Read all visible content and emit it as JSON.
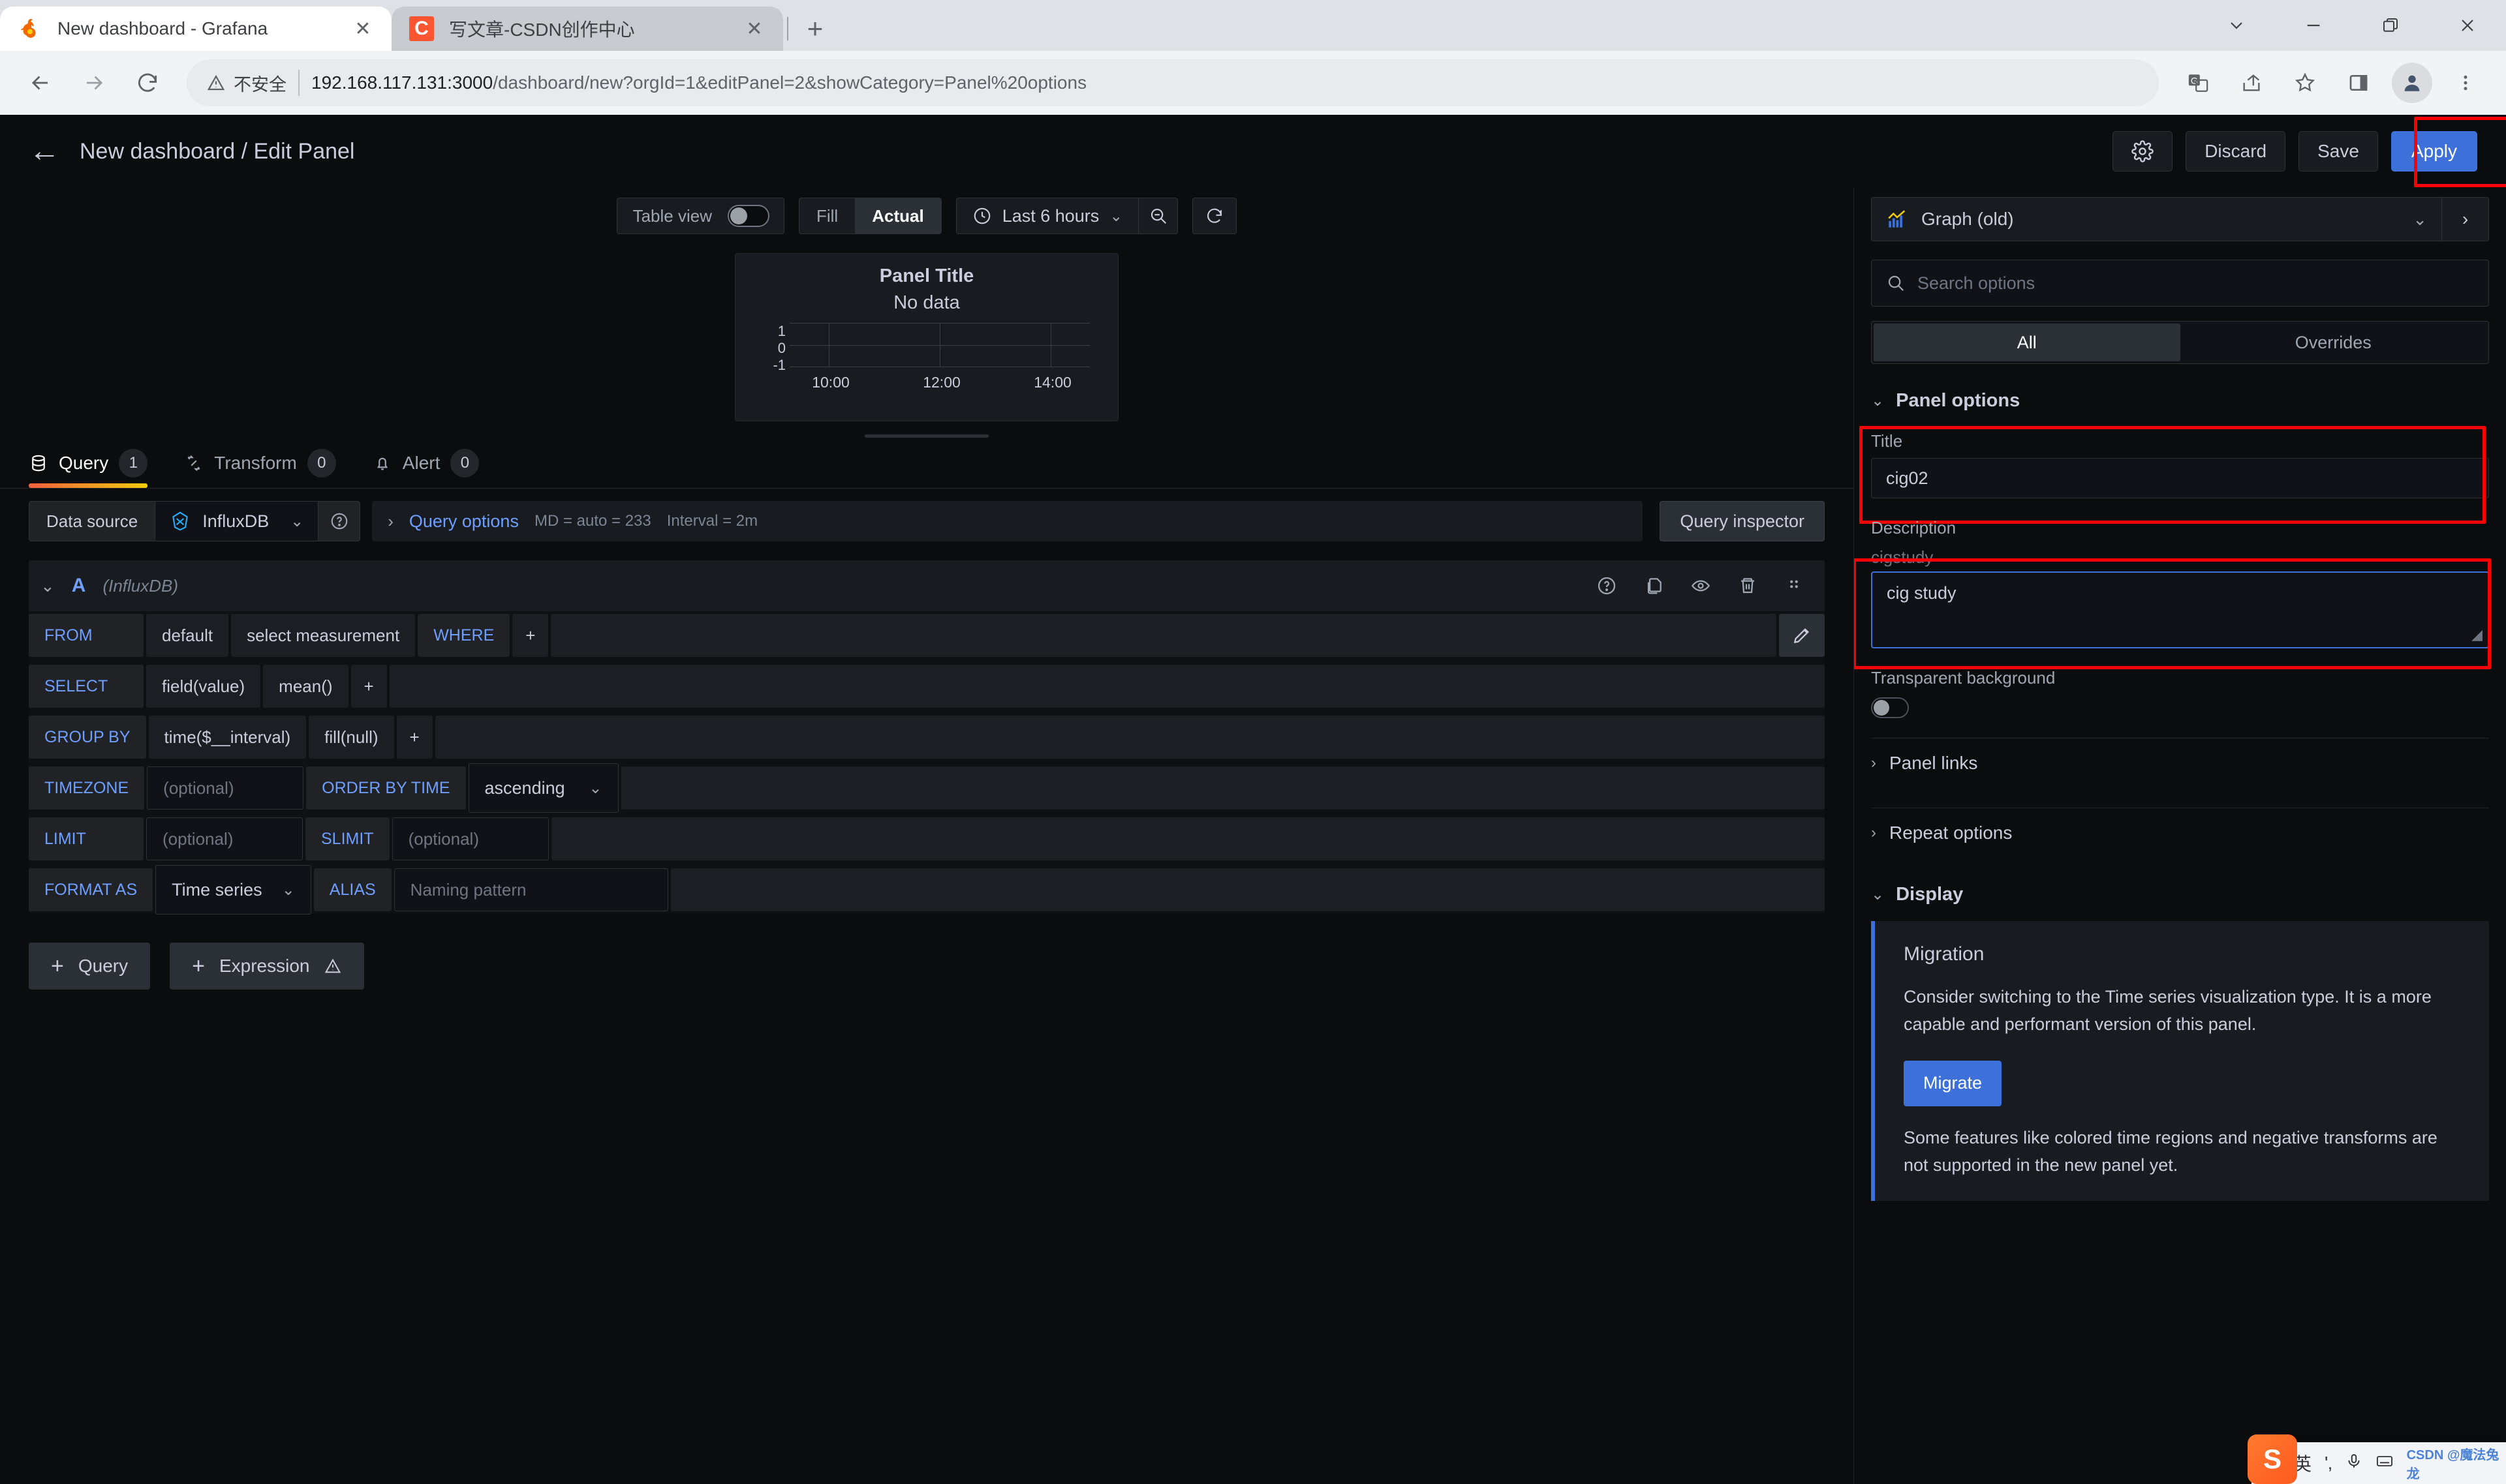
{
  "browser": {
    "tabs": [
      {
        "title": "New dashboard - Grafana",
        "favicon": "grafana-logo-icon",
        "active": true
      },
      {
        "title": "写文章-CSDN创作中心",
        "favicon": "csdn-logo-icon",
        "active": false
      }
    ],
    "new_tab_label": "+",
    "close_label": "✕",
    "window_controls": [
      "chevron-down",
      "minimize",
      "restore",
      "close"
    ],
    "omnibox": {
      "warning_text": "不安全",
      "url_host": "192.168.117.131:3000",
      "url_path": "/dashboard/new?orgId=1&editPanel=2&showCategory=Panel%20options"
    }
  },
  "grafana": {
    "header": {
      "breadcrumb": "New dashboard / Edit Panel",
      "settings_label": "",
      "discard_label": "Discard",
      "save_label": "Save",
      "apply_label": "Apply",
      "accent_blue": "#3d71d9",
      "highlight_red": "#ff0000"
    },
    "viz_toolbar": {
      "table_view_label": "Table view",
      "table_view_on": false,
      "fill_label": "Fill",
      "actual_label": "Actual",
      "fill_actual_selected": "Actual",
      "time_range": "Last 6 hours",
      "zoom_out_icon": "zoom-out-icon",
      "refresh_icon": "refresh-icon"
    },
    "panel_preview": {
      "title": "Panel Title",
      "no_data": "No data"
    },
    "tabs": [
      {
        "label": "Query",
        "badge": "1",
        "icon": "database-icon",
        "active": true
      },
      {
        "label": "Transform",
        "badge": "0",
        "icon": "transform-icon",
        "active": false
      },
      {
        "label": "Alert",
        "badge": "0",
        "icon": "bell-icon",
        "active": false
      }
    ],
    "datasource_row": {
      "label": "Data source",
      "value": "InfluxDB",
      "help_icon": "question-circle-icon",
      "query_options_label": "Query options",
      "md_text": "MD = auto = 233",
      "interval_text": "Interval = 2m",
      "query_inspector_label": "Query inspector"
    },
    "query": {
      "ref_id": "A",
      "datasource_note": "(InfluxDB)",
      "row_icons": [
        "question-circle-icon",
        "duplicate-icon",
        "eye-icon",
        "trash-icon",
        "drag-handle-icon"
      ],
      "rows": [
        {
          "key": "FROM",
          "segments": [
            "default",
            "select measurement"
          ],
          "key2": "WHERE",
          "plus": "+"
        },
        {
          "key": "SELECT",
          "segments": [
            "field(value)",
            "mean()"
          ],
          "plus": "+"
        },
        {
          "key": "GROUP BY",
          "segments": [
            "time($__interval)",
            "fill(null)"
          ],
          "plus": "+"
        }
      ],
      "timezone": {
        "key": "TIMEZONE",
        "placeholder": "(optional)",
        "key2": "ORDER BY TIME",
        "order_value": "ascending"
      },
      "limit": {
        "key": "LIMIT",
        "placeholder": "(optional)",
        "key2": "SLIMIT",
        "placeholder2": "(optional)"
      },
      "format": {
        "key": "FORMAT AS",
        "value": "Time series",
        "key2": "ALIAS",
        "alias_placeholder": "Naming pattern"
      },
      "edit_icon": "pencil-icon"
    },
    "add_buttons": {
      "query_label": "Query",
      "expression_label": "Expression",
      "expression_warn_icon": "warning-triangle-icon"
    },
    "options_pane": {
      "viz_type": "Graph (old)",
      "viz_icon": "graph-icon",
      "search_placeholder": "Search options",
      "tab_all": "All",
      "tab_overrides": "Overrides",
      "all_selected": true,
      "panel_options_title": "Panel options",
      "title_label": "Title",
      "title_value": "cig02",
      "description_label": "Description",
      "description_ghost": "cigstudy",
      "description_value": "cig study",
      "transparent_label": "Transparent background",
      "transparent_on": false,
      "panel_links_label": "Panel links",
      "repeat_options_label": "Repeat options",
      "display_title": "Display",
      "migration_title": "Migration",
      "migration_text": "Consider switching to the Time series visualization type. It is a more capable and performant version of this panel.",
      "migrate_label": "Migrate",
      "migration_text2": "Some features like colored time regions and negative transforms are not supported in the new panel yet."
    }
  },
  "chart_data": {
    "type": "line",
    "title": "Panel Title",
    "subtitle": "No data",
    "x": [],
    "series": [],
    "xlabel": "",
    "ylabel": "",
    "x_ticks": [
      "10:00",
      "12:00",
      "14:00"
    ],
    "y_ticks": [
      "1",
      "0",
      "-1"
    ],
    "ylim": [
      -1,
      1
    ],
    "grid": true,
    "legend": "none"
  },
  "ime": {
    "mode_label": "英",
    "punct_icon": "punctuation-icon",
    "mic_icon": "microphone-icon",
    "keyboard_icon": "keyboard-icon",
    "watermark": "CSDN @魔法兔龙"
  }
}
